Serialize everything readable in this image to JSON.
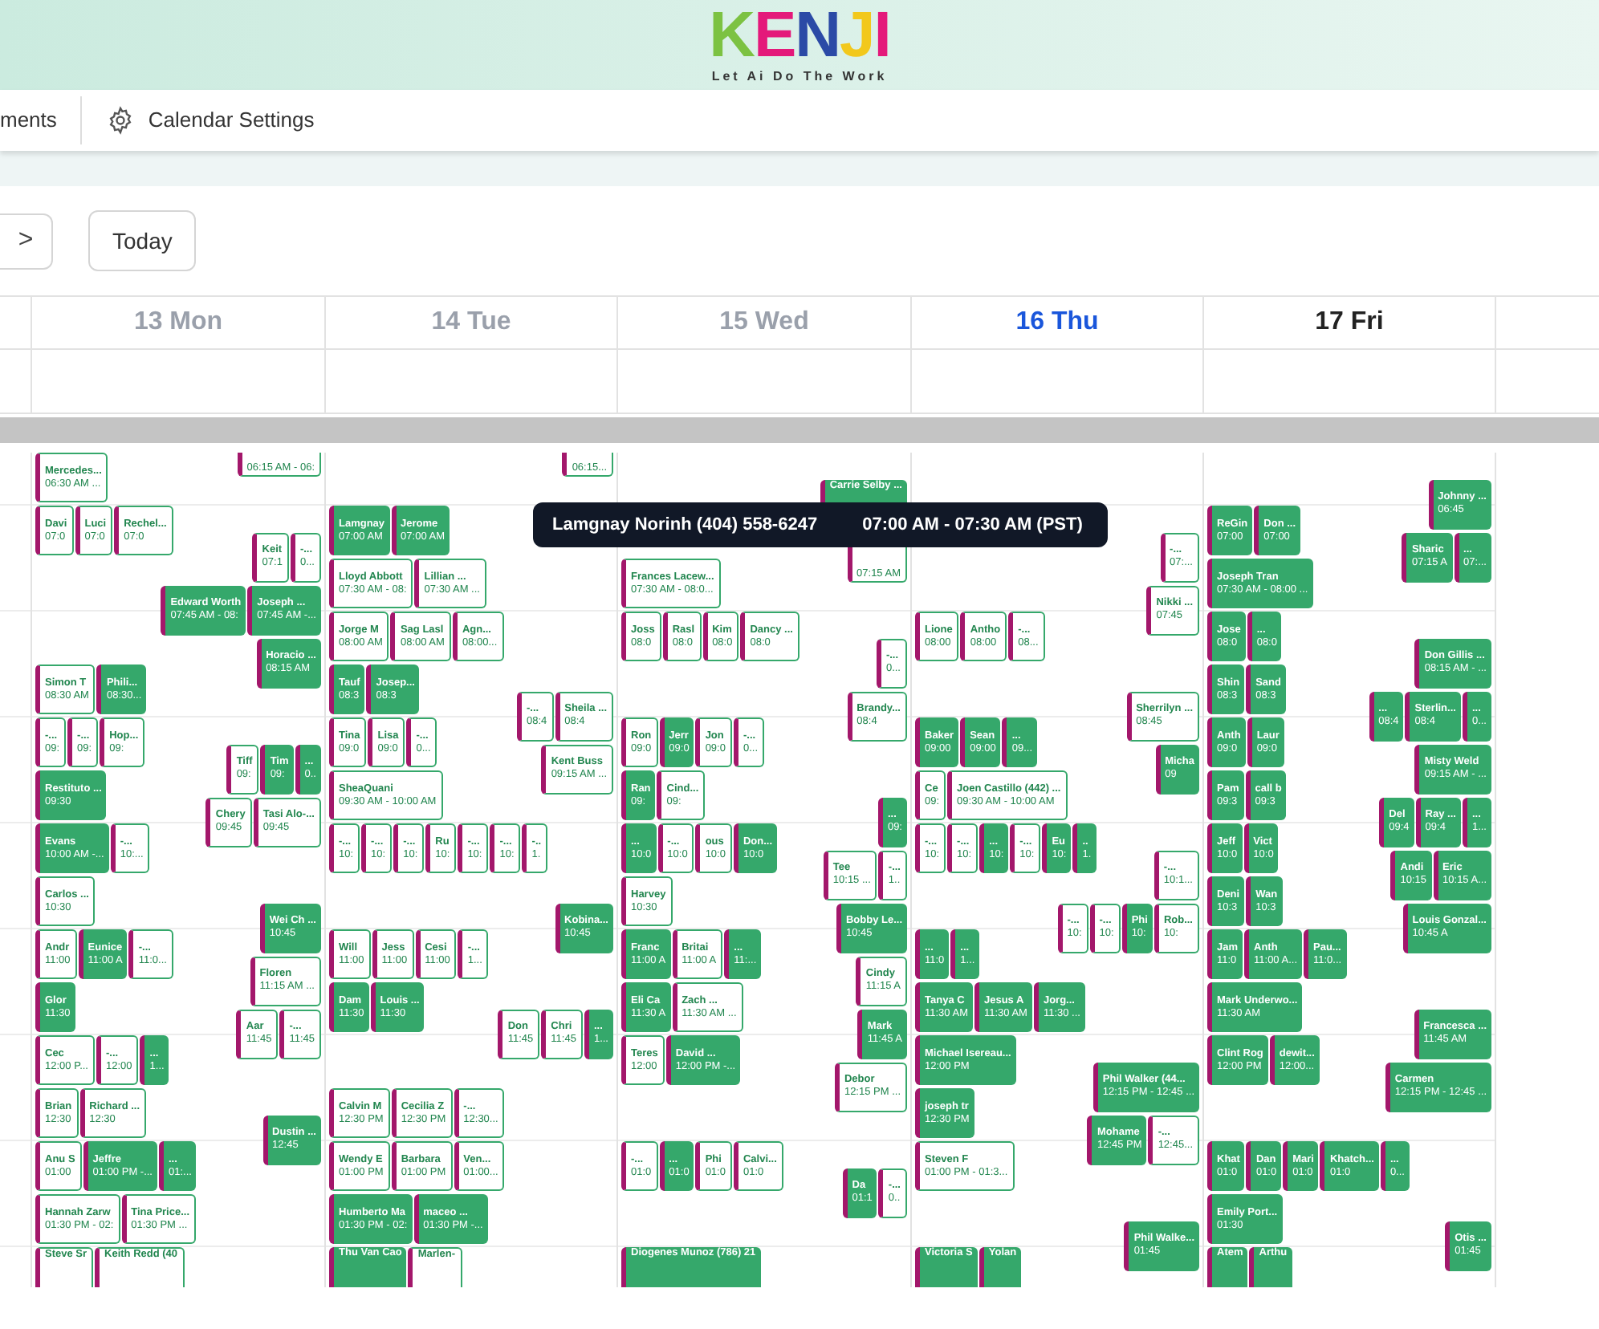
{
  "brand": {
    "logo": "KENJI",
    "tagline": "Let Ai Do The Work"
  },
  "nav": [
    {
      "label": "ments"
    },
    {
      "label": "Calendar Settings"
    }
  ],
  "toolbar": {
    "next": ">",
    "today": "Today"
  },
  "days": [
    {
      "label": "13 Mon",
      "past": true,
      "selected": false,
      "slots": {
        "06:15": [
          {
            "time": "06:15 AM - 06:",
            "cancelled": true
          }
        ],
        "06:30": [
          {
            "title": "Mercedes...",
            "time": "06:30 AM ...",
            "cancelled": true
          }
        ],
        "07:00": [
          {
            "title": "Davi",
            "time": "07:0",
            "cancelled": true
          },
          {
            "title": "Luci",
            "time": "07:0",
            "cancelled": true
          },
          {
            "title": "Rechel...",
            "time": "07:0",
            "cancelled": true
          }
        ],
        "07:15": [
          {
            "title": "Keit",
            "time": "07:1",
            "cancelled": true
          },
          {
            "title": "-...",
            "time": "0...",
            "cancelled": true
          }
        ],
        "07:45": [
          {
            "title": "Edward Worth",
            "time": "07:45 AM - 08:",
            "cancelled": false
          },
          {
            "title": "Joseph ...",
            "time": "07:45 AM -...",
            "cancelled": false
          }
        ],
        "08:15": [
          {
            "title": "Horacio ...",
            "time": "08:15 AM",
            "cancelled": false
          }
        ],
        "08:30": [
          {
            "title": "Simon T",
            "time": "08:30 AM",
            "cancelled": true
          },
          {
            "title": "Phili...",
            "time": "08:30...",
            "cancelled": false
          }
        ],
        "09:00": [
          {
            "title": "-...",
            "time": "09:",
            "cancelled": true
          },
          {
            "title": "-...",
            "time": "09:",
            "cancelled": true
          },
          {
            "title": "Hop...",
            "time": "09:",
            "cancelled": true
          }
        ],
        "09:15": [
          {
            "title": "Tiff",
            "time": "09:",
            "cancelled": true
          },
          {
            "title": "Tim",
            "time": "09:",
            "cancelled": false
          },
          {
            "title": "...",
            "time": "0..",
            "cancelled": false
          }
        ],
        "09:30": [
          {
            "title": "Restituto ...",
            "time": "09:30",
            "cancelled": false
          }
        ],
        "09:45": [
          {
            "title": "Chery",
            "time": "09:45",
            "cancelled": true
          },
          {
            "title": "Tasi Alo-...",
            "time": "09:45",
            "cancelled": true
          }
        ],
        "10:00": [
          {
            "title": "Evans",
            "time": "10:00 AM -...",
            "cancelled": false
          },
          {
            "title": "-...",
            "time": "10:...",
            "cancelled": true
          }
        ],
        "10:30": [
          {
            "title": "Carlos ...",
            "time": "10:30",
            "cancelled": true
          }
        ],
        "10:45": [
          {
            "title": "Wei Ch ...",
            "time": "10:45",
            "cancelled": false
          }
        ],
        "11:00": [
          {
            "title": "Andr",
            "time": "11:00",
            "cancelled": true
          },
          {
            "title": "Eunice",
            "time": "11:00 A",
            "cancelled": false
          },
          {
            "title": "-...",
            "time": "11:0...",
            "cancelled": true
          }
        ],
        "11:15": [
          {
            "title": "Floren",
            "time": "11:15 AM ...",
            "cancelled": true
          }
        ],
        "11:30": [
          {
            "title": "Glor",
            "time": "11:30",
            "cancelled": false
          }
        ],
        "11:45": [
          {
            "title": "Aar",
            "time": "11:45",
            "cancelled": true
          },
          {
            "title": "-...",
            "time": "11:45",
            "cancelled": true
          }
        ],
        "12:00": [
          {
            "title": "Cec",
            "time": "12:00 P...",
            "cancelled": true
          },
          {
            "title": "-...",
            "time": "12:00",
            "cancelled": true
          },
          {
            "title": "...",
            "time": "1...",
            "cancelled": false
          }
        ],
        "12:30": [
          {
            "title": "Brian",
            "time": "12:30",
            "cancelled": true
          },
          {
            "title": "Richard ...",
            "time": "12:30",
            "cancelled": true
          }
        ],
        "12:45": [
          {
            "title": "Dustin ...",
            "time": "12:45",
            "cancelled": false
          }
        ],
        "01:00": [
          {
            "title": "Anu S",
            "time": "01:00",
            "cancelled": true
          },
          {
            "title": "Jeffre",
            "time": "01:00 PM -...",
            "cancelled": false
          },
          {
            "title": "...",
            "time": "01:...",
            "cancelled": false
          }
        ],
        "01:30": [
          {
            "title": "Hannah Zarw",
            "time": "01:30 PM - 02:",
            "cancelled": true
          },
          {
            "title": "Tina Price...",
            "time": "01:30 PM ...",
            "cancelled": true
          }
        ],
        "02:00": [
          {
            "title": "Steve Sr",
            "cancelled": true
          },
          {
            "title": "Keith Redd (40",
            "cancelled": true
          }
        ]
      }
    },
    {
      "label": "14 Tue",
      "past": true,
      "selected": false,
      "slots": {
        "06:15": [
          {
            "time": "06:15...",
            "cancelled": true
          }
        ],
        "07:00": [
          {
            "title": "Lamgnay",
            "time": "07:00 AM",
            "cancelled": false
          },
          {
            "title": "Jerome",
            "time": "07:00 AM",
            "cancelled": false
          }
        ],
        "07:30": [
          {
            "title": "Lloyd Abbott",
            "time": "07:30 AM - 08:",
            "cancelled": true
          },
          {
            "title": "Lillian ...",
            "time": "07:30 AM ...",
            "cancelled": true
          }
        ],
        "08:00": [
          {
            "title": "Jorge M",
            "time": "08:00 AM",
            "cancelled": true
          },
          {
            "title": "Sag Lasl",
            "time": "08:00 AM",
            "cancelled": true
          },
          {
            "title": "Agn...",
            "time": "08:00...",
            "cancelled": true
          }
        ],
        "08:30": [
          {
            "title": "Tauf",
            "time": "08:3",
            "cancelled": false
          },
          {
            "title": "Josep...",
            "time": "08:3",
            "cancelled": false
          }
        ],
        "08:45": [
          {
            "title": "-...",
            "time": "08:4",
            "cancelled": true
          },
          {
            "title": "Sheila ...",
            "time": "08:4",
            "cancelled": true
          }
        ],
        "09:00": [
          {
            "title": "Tina",
            "time": "09:0",
            "cancelled": true
          },
          {
            "title": "Lisa",
            "time": "09:0",
            "cancelled": true
          },
          {
            "title": "-...",
            "time": "0...",
            "cancelled": true
          }
        ],
        "09:15": [
          {
            "title": "Kent Buss",
            "time": "09:15 AM ...",
            "cancelled": true
          }
        ],
        "09:30": [
          {
            "title": "SheaQuani",
            "time": "09:30 AM - 10:00 AM",
            "cancelled": true
          }
        ],
        "10:00": [
          {
            "title": "-...",
            "time": "10:",
            "cancelled": true
          },
          {
            "title": "-...",
            "time": "10:",
            "cancelled": true
          },
          {
            "title": "-...",
            "time": "10:",
            "cancelled": true
          },
          {
            "title": "Ru",
            "time": "10:",
            "cancelled": true
          },
          {
            "title": "-...",
            "time": "10:",
            "cancelled": true
          },
          {
            "title": "-...",
            "time": "10:",
            "cancelled": true
          },
          {
            "title": "-..",
            "time": "1.",
            "cancelled": true
          }
        ],
        "10:45": [
          {
            "title": "Kobina...",
            "time": "10:45",
            "cancelled": false
          }
        ],
        "11:00": [
          {
            "title": "Will",
            "time": "11:00",
            "cancelled": true
          },
          {
            "title": "Jess",
            "time": "11:00",
            "cancelled": true
          },
          {
            "title": "Cesi",
            "time": "11:00",
            "cancelled": true
          },
          {
            "title": "-...",
            "time": "1...",
            "cancelled": true
          }
        ],
        "11:30": [
          {
            "title": "Dam",
            "time": "11:30",
            "cancelled": false
          },
          {
            "title": "Louis ...",
            "time": "11:30",
            "cancelled": false
          }
        ],
        "11:45": [
          {
            "title": "Don",
            "time": "11:45",
            "cancelled": true
          },
          {
            "title": "Chri",
            "time": "11:45",
            "cancelled": true
          },
          {
            "title": "...",
            "time": "1...",
            "cancelled": false
          }
        ],
        "12:30": [
          {
            "title": "Calvin M",
            "time": "12:30 PM",
            "cancelled": true
          },
          {
            "title": "Cecilia Z",
            "time": "12:30 PM",
            "cancelled": true
          },
          {
            "title": "-...",
            "time": "12:30...",
            "cancelled": true
          }
        ],
        "01:00": [
          {
            "title": "Wendy E",
            "time": "01:00 PM",
            "cancelled": true
          },
          {
            "title": "Barbara",
            "time": "01:00 PM",
            "cancelled": true
          },
          {
            "title": "Ven...",
            "time": "01:00...",
            "cancelled": true
          }
        ],
        "01:30": [
          {
            "title": "Humberto Ma",
            "time": "01:30 PM - 02:",
            "cancelled": false
          },
          {
            "title": "maceo ...",
            "time": "01:30 PM -...",
            "cancelled": false
          }
        ],
        "02:00": [
          {
            "title": "Thu Van Cao",
            "cancelled": false
          },
          {
            "title": "Marlen-",
            "cancelled": true
          }
        ]
      }
    },
    {
      "label": "15 Wed",
      "past": true,
      "selected": false,
      "slots": {
        "06:45": [
          {
            "title": "Carrie Selby ...",
            "cancelled": false
          }
        ],
        "07:15": [
          {
            "time": "07:15 AM",
            "cancelled": true
          }
        ],
        "07:30": [
          {
            "title": "Frances Lacew...",
            "time": "07:30 AM - 08:0...",
            "cancelled": true
          }
        ],
        "08:00": [
          {
            "title": "Joss",
            "time": "08:0",
            "cancelled": true
          },
          {
            "title": "Rasl",
            "time": "08:0",
            "cancelled": true
          },
          {
            "title": "Kim",
            "time": "08:0",
            "cancelled": true
          },
          {
            "title": "Dancy ...",
            "time": "08:0",
            "cancelled": true
          }
        ],
        "08:15": [
          {
            "title": "-...",
            "time": "0...",
            "cancelled": true
          }
        ],
        "08:45": [
          {
            "title": "Brandy...",
            "time": "08:4",
            "cancelled": true
          }
        ],
        "09:00": [
          {
            "title": "Ron",
            "time": "09:0",
            "cancelled": true
          },
          {
            "title": "Jerr",
            "time": "09:0",
            "cancelled": false
          },
          {
            "title": "Jon",
            "time": "09:0",
            "cancelled": true
          },
          {
            "title": "-...",
            "time": "0...",
            "cancelled": true
          }
        ],
        "09:30": [
          {
            "title": "Ran",
            "time": "09:",
            "cancelled": false
          },
          {
            "title": "Cind...",
            "time": "09:",
            "cancelled": true
          }
        ],
        "09:45": [
          {
            "title": "...",
            "time": "09:",
            "cancelled": false
          }
        ],
        "10:00": [
          {
            "title": "...",
            "time": "10:0",
            "cancelled": false
          },
          {
            "title": "-...",
            "time": "10:0",
            "cancelled": true
          },
          {
            "title": "ous",
            "time": "10:0",
            "cancelled": true
          },
          {
            "title": "Don...",
            "time": "10:0",
            "cancelled": false
          }
        ],
        "10:15": [
          {
            "title": "Tee",
            "time": "10:15 ...",
            "cancelled": true
          },
          {
            "title": "-...",
            "time": "1..",
            "cancelled": true
          }
        ],
        "10:30": [
          {
            "title": "Harvey",
            "time": "10:30",
            "cancelled": true
          }
        ],
        "10:45": [
          {
            "title": "Bobby Le...",
            "time": "10:45",
            "cancelled": false
          }
        ],
        "11:00": [
          {
            "title": "Franc",
            "time": "11:00 A",
            "cancelled": false
          },
          {
            "title": "Britai",
            "time": "11:00 A",
            "cancelled": true
          },
          {
            "title": "...",
            "time": "11:...",
            "cancelled": false
          }
        ],
        "11:15": [
          {
            "title": "Cindy",
            "time": "11:15 A",
            "cancelled": true
          }
        ],
        "11:30": [
          {
            "title": "Eli Ca",
            "time": "11:30 A",
            "cancelled": false
          },
          {
            "title": "Zach ...",
            "time": "11:30 AM ...",
            "cancelled": true
          }
        ],
        "11:45": [
          {
            "title": "Mark",
            "time": "11:45 A",
            "cancelled": false
          }
        ],
        "12:00": [
          {
            "title": "Teres",
            "time": "12:00",
            "cancelled": true
          },
          {
            "title": "David ...",
            "time": "12:00 PM -...",
            "cancelled": false
          }
        ],
        "12:15": [
          {
            "title": "Debor",
            "time": "12:15 PM ...",
            "cancelled": true
          }
        ],
        "01:00": [
          {
            "title": "-...",
            "time": "01:0",
            "cancelled": true
          },
          {
            "title": "...",
            "time": "01:0",
            "cancelled": false
          },
          {
            "title": "Phi",
            "time": "01:0",
            "cancelled": true
          },
          {
            "title": "Calvi...",
            "time": "01:0",
            "cancelled": true
          }
        ],
        "01:15": [
          {
            "title": "Da",
            "time": "01:1",
            "cancelled": false
          },
          {
            "title": "-...",
            "time": "0..",
            "cancelled": true
          }
        ],
        "02:00": [
          {
            "title": "Diogenes Munoz (786) 21",
            "cancelled": false
          }
        ]
      }
    },
    {
      "label": "16 Thu",
      "past": false,
      "selected": true,
      "slots": {
        "07:15": [
          {
            "title": "-...",
            "time": "07:...",
            "cancelled": true
          }
        ],
        "07:45": [
          {
            "title": "Nikki ...",
            "time": "07:45",
            "cancelled": true
          }
        ],
        "08:00": [
          {
            "title": "Lione",
            "time": "08:00",
            "cancelled": true
          },
          {
            "title": "Antho",
            "time": "08:00",
            "cancelled": true
          },
          {
            "title": "-...",
            "time": "08...",
            "cancelled": true
          }
        ],
        "08:45": [
          {
            "title": "Sherrilyn ...",
            "time": "08:45",
            "cancelled": true
          }
        ],
        "09:00": [
          {
            "title": "Baker",
            "time": "09:00",
            "cancelled": false
          },
          {
            "title": "Sean",
            "time": "09:00",
            "cancelled": false
          },
          {
            "title": "...",
            "time": "09...",
            "cancelled": false
          }
        ],
        "09:15": [
          {
            "title": "Micha",
            "time": "09",
            "cancelled": false
          }
        ],
        "09:30": [
          {
            "title": "Ce",
            "time": "09:",
            "cancelled": true
          },
          {
            "title": "Joen Castillo (442) ...",
            "time": "09:30 AM - 10:00 AM",
            "cancelled": true
          }
        ],
        "10:00": [
          {
            "title": "-...",
            "time": "10:",
            "cancelled": true
          },
          {
            "title": "-...",
            "time": "10:",
            "cancelled": true
          },
          {
            "title": "...",
            "time": "10:",
            "cancelled": false
          },
          {
            "title": "-...",
            "time": "10:",
            "cancelled": true
          },
          {
            "title": "Eu",
            "time": "10:",
            "cancelled": false
          },
          {
            "title": "..",
            "time": "1.",
            "cancelled": false
          }
        ],
        "10:15": [
          {
            "title": "-...",
            "time": "10:1...",
            "cancelled": true
          }
        ],
        "10:45": [
          {
            "title": "-...",
            "time": "10:",
            "cancelled": true
          },
          {
            "title": "-...",
            "time": "10:",
            "cancelled": true
          },
          {
            "title": "Phi",
            "time": "10:",
            "cancelled": false
          },
          {
            "title": "Rob...",
            "time": "10:",
            "cancelled": true
          }
        ],
        "11:00": [
          {
            "title": "...",
            "time": "11:0",
            "cancelled": false
          },
          {
            "title": "...",
            "time": "1...",
            "cancelled": false
          }
        ],
        "11:30": [
          {
            "title": "Tanya C",
            "time": "11:30 AM",
            "cancelled": false
          },
          {
            "title": "Jesus A",
            "time": "11:30 AM",
            "cancelled": false
          },
          {
            "title": "Jorg...",
            "time": "11:30 ...",
            "cancelled": false
          }
        ],
        "12:00": [
          {
            "title": "Michael Isereau...",
            "time": "12:00 PM",
            "cancelled": false
          }
        ],
        "12:15": [
          {
            "title": "Phil Walker (44...",
            "time": "12:15 PM - 12:45 ...",
            "cancelled": false
          }
        ],
        "12:30": [
          {
            "title": "joseph tr",
            "time": "12:30 PM",
            "cancelled": false
          }
        ],
        "12:45": [
          {
            "title": "Mohame",
            "time": "12:45 PM",
            "cancelled": false
          },
          {
            "title": "-...",
            "time": "12:45...",
            "cancelled": true
          }
        ],
        "01:00": [
          {
            "title": "Steven F",
            "time": "01:00 PM - 01:3...",
            "cancelled": true
          }
        ],
        "01:45": [
          {
            "title": "Phil Walke...",
            "time": "01:45",
            "cancelled": false
          }
        ],
        "02:00": [
          {
            "title": "Victoria S",
            "cancelled": false
          },
          {
            "title": "Yolan",
            "cancelled": false
          }
        ]
      }
    },
    {
      "label": "17 Fri",
      "past": false,
      "selected": false,
      "slots": {
        "06:45": [
          {
            "title": "Johnny ...",
            "time": "06:45",
            "cancelled": false
          }
        ],
        "07:00": [
          {
            "title": "ReGin",
            "time": "07:00",
            "cancelled": false
          },
          {
            "title": "Don ...",
            "time": "07:00",
            "cancelled": false
          }
        ],
        "07:15": [
          {
            "title": "Sharic",
            "time": "07:15 A",
            "cancelled": false
          },
          {
            "title": "...",
            "time": "07:...",
            "cancelled": false
          }
        ],
        "07:30": [
          {
            "title": "Joseph Tran",
            "time": "07:30 AM - 08:00 ...",
            "cancelled": false
          }
        ],
        "08:00": [
          {
            "title": "Jose",
            "time": "08:0",
            "cancelled": false
          },
          {
            "title": "...",
            "time": "08:0",
            "cancelled": false
          }
        ],
        "08:15": [
          {
            "title": "Don Gillis ...",
            "time": "08:15 AM - ...",
            "cancelled": false
          }
        ],
        "08:30": [
          {
            "title": "Shin",
            "time": "08:3",
            "cancelled": false
          },
          {
            "title": "Sand",
            "time": "08:3",
            "cancelled": false
          }
        ],
        "08:45": [
          {
            "title": "...",
            "time": "08:4",
            "cancelled": false
          },
          {
            "title": "Sterlin...",
            "time": "08:4",
            "cancelled": false
          },
          {
            "title": "...",
            "time": "0...",
            "cancelled": false
          }
        ],
        "09:00": [
          {
            "title": "Anth",
            "time": "09:0",
            "cancelled": false
          },
          {
            "title": "Laur",
            "time": "09:0",
            "cancelled": false
          }
        ],
        "09:15": [
          {
            "title": "Misty Weld",
            "time": "09:15 AM - ...",
            "cancelled": false
          }
        ],
        "09:30": [
          {
            "title": "Pam",
            "time": "09:3",
            "cancelled": false
          },
          {
            "title": "call b",
            "time": "09:3",
            "cancelled": false
          }
        ],
        "09:45": [
          {
            "title": "Del",
            "time": "09:4",
            "cancelled": false
          },
          {
            "title": "Ray ...",
            "time": "09:4",
            "cancelled": false
          },
          {
            "title": "...",
            "time": "1...",
            "cancelled": false
          }
        ],
        "10:00": [
          {
            "title": "Jeff",
            "time": "10:0",
            "cancelled": false
          },
          {
            "title": "Vict",
            "time": "10:0",
            "cancelled": false
          }
        ],
        "10:15": [
          {
            "title": "Andi",
            "time": "10:15",
            "cancelled": false
          },
          {
            "title": "Eric",
            "time": "10:15 A...",
            "cancelled": false
          }
        ],
        "10:30": [
          {
            "title": "Deni",
            "time": "10:3",
            "cancelled": false
          },
          {
            "title": "Wan",
            "time": "10:3",
            "cancelled": false
          }
        ],
        "10:45": [
          {
            "title": "Louis Gonzal...",
            "time": "10:45 A",
            "cancelled": false
          }
        ],
        "11:00": [
          {
            "title": "Jam",
            "time": "11:0",
            "cancelled": false
          },
          {
            "title": "Anth",
            "time": "11:00 A...",
            "cancelled": false
          },
          {
            "title": "Pau...",
            "time": "11:0...",
            "cancelled": false
          }
        ],
        "11:30": [
          {
            "title": "Mark Underwo...",
            "time": "11:30 AM",
            "cancelled": false
          }
        ],
        "11:45": [
          {
            "title": "Francesca ...",
            "time": "11:45 AM",
            "cancelled": false
          }
        ],
        "12:00": [
          {
            "title": "Clint Rog",
            "time": "12:00 PM",
            "cancelled": false
          },
          {
            "title": "dewit...",
            "time": "12:00...",
            "cancelled": false
          }
        ],
        "12:15": [
          {
            "title": "Carmen",
            "time": "12:15 PM - 12:45 ...",
            "cancelled": false
          }
        ],
        "01:00": [
          {
            "title": "Khat",
            "time": "01:0",
            "cancelled": false
          },
          {
            "title": "Dan",
            "time": "01:0",
            "cancelled": false
          },
          {
            "title": "Mari",
            "time": "01:0",
            "cancelled": false
          },
          {
            "title": "Khatch...",
            "time": "01:0",
            "cancelled": false
          },
          {
            "title": "...",
            "time": "0...",
            "cancelled": false
          }
        ],
        "01:30": [
          {
            "title": "Emily Port...",
            "time": "01:30",
            "cancelled": false
          }
        ],
        "01:45": [
          {
            "title": "Otis ...",
            "time": "01:45",
            "cancelled": false
          }
        ],
        "02:00": [
          {
            "title": "Atem",
            "cancelled": false
          },
          {
            "title": "Arthu",
            "cancelled": false
          }
        ]
      }
    }
  ],
  "tooltip": {
    "title": "Lamgnay Norinh (404) 558-6247",
    "time": "07:00 AM - 07:30 AM (PST)"
  }
}
